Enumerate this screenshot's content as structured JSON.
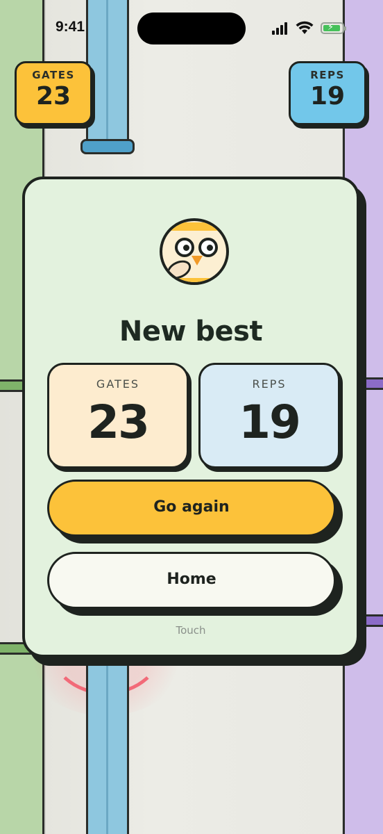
{
  "status_bar": {
    "time": "9:41"
  },
  "hud": {
    "gates": {
      "label": "GATES",
      "value": "23"
    },
    "reps": {
      "label": "REPS",
      "value": "19"
    }
  },
  "modal": {
    "title": "New best",
    "stats": {
      "gates": {
        "label": "GATES",
        "value": "23"
      },
      "reps": {
        "label": "REPS",
        "value": "19"
      }
    },
    "buttons": {
      "go_again": "Go again",
      "home": "Home"
    },
    "hint": "Touch"
  },
  "colors": {
    "accent_yellow": "#fcc23a",
    "accent_blue": "#72c7ea",
    "card_bg": "#e3f2de",
    "outline": "#1e231f"
  },
  "icons": {
    "avatar": "owl-avatar-icon"
  }
}
